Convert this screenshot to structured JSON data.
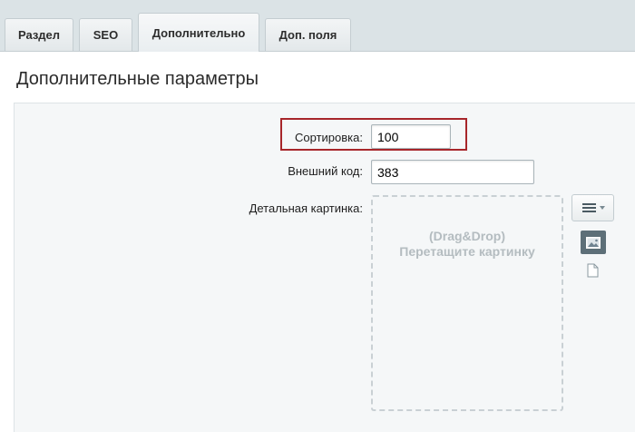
{
  "tabs": [
    {
      "label": "Раздел"
    },
    {
      "label": "SEO"
    },
    {
      "label": "Дополнительно"
    },
    {
      "label": "Доп. поля"
    }
  ],
  "active_tab": "Дополнительно",
  "panel": {
    "title": "Дополнительные параметры"
  },
  "form": {
    "sort": {
      "label": "Сортировка:",
      "value": "100"
    },
    "external_code": {
      "label": "Внешний код:",
      "value": "383"
    },
    "detail_image": {
      "label": "Детальная картинка:",
      "drop_hint_1": "(Drag&Drop)",
      "drop_hint_2": "Перетащите картинку"
    }
  },
  "icons": {
    "menu": "hamburger-dropdown-icon",
    "image": "image-icon",
    "file": "file-icon"
  },
  "colors": {
    "highlight_border": "#a7262a",
    "image_button": "#5d6f78"
  }
}
